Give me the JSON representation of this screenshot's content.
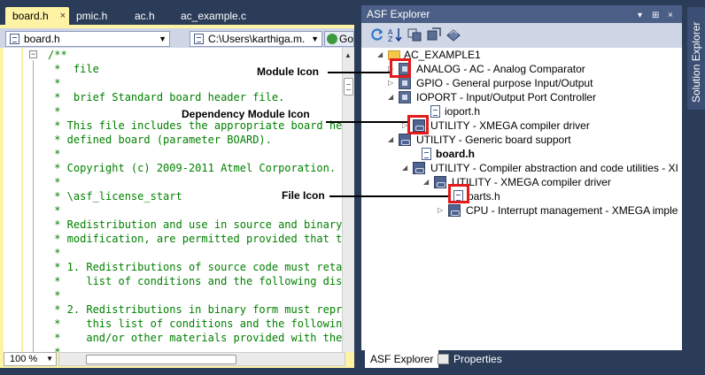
{
  "editor": {
    "tabs": [
      {
        "label": "board.h",
        "close": "×"
      },
      {
        "label": "pmic.h"
      },
      {
        "label": "ac.h"
      },
      {
        "label": "ac_example.c"
      }
    ],
    "file_combo": "board.h",
    "path_combo": "C:\\Users\\karthiga.m.",
    "go_label": "Go",
    "collapse": "−",
    "code_lines": [
      "/**",
      " *  file",
      " *",
      " *  brief Standard board header file.",
      " *",
      " * This file includes the appropriate board heade",
      " * defined board (parameter BOARD).",
      " *",
      " * Copyright (c) 2009-2011 Atmel Corporation. All",
      " *",
      " * \\asf_license_start",
      " *",
      " * Redistribution and use in source and binary fo",
      " * modification, are permitted provided that the ",
      " *",
      " * 1. Redistributions of source code must retain ",
      " *    list of conditions and the following discla",
      " *",
      " * 2. Redistributions in binary form must reprodu",
      " *    this list of conditions and the following ",
      " *    and/or other materials provided with the di",
      " *"
    ],
    "zoom": "100 %"
  },
  "asf": {
    "title": "ASF Explorer",
    "header_buttons": [
      "▾",
      "⊞",
      "×"
    ],
    "tree": [
      {
        "label": "AC_EXAMPLE1",
        "icon": "folder-icon",
        "exp": "◢"
      },
      {
        "label": "ANALOG - AC - Analog Comparator",
        "icon": "module-icon",
        "exp": "▷"
      },
      {
        "label": "GPIO - General purpose Input/Output",
        "icon": "module-icon",
        "exp": "▷"
      },
      {
        "label": "IOPORT - Input/Output Port Controller",
        "icon": "module-icon",
        "exp": "◢"
      },
      {
        "label": "ioport.h",
        "icon": "file-icon",
        "exp": ""
      },
      {
        "label": "UTILITY - XMEGA compiler driver",
        "icon": "dependency-module-icon",
        "exp": "▷"
      },
      {
        "label": "UTILITY - Generic board support",
        "icon": "dependency-module-icon",
        "exp": "◢"
      },
      {
        "label": "board.h",
        "icon": "file-icon",
        "exp": "",
        "bold": true
      },
      {
        "label": "UTILITY - Compiler abstraction and code utilities - XI",
        "icon": "dependency-module-icon",
        "exp": "◢"
      },
      {
        "label": "UTILITY - XMEGA compiler driver",
        "icon": "dependency-module-icon",
        "exp": "◢"
      },
      {
        "label": "parts.h",
        "icon": "file-icon",
        "exp": ""
      },
      {
        "label": "CPU - Interrupt management - XMEGA imple",
        "icon": "dependency-module-icon",
        "exp": "▷"
      }
    ],
    "bottom_tabs": {
      "explorer": "ASF Explorer",
      "properties": "Properties"
    }
  },
  "side_tab": "Solution Explorer",
  "annotations": {
    "module_icon": "Module Icon",
    "dependency_module_icon": "Dependency Module Icon",
    "file_icon": "File Icon"
  },
  "colors": {
    "frame": "#2b3c59",
    "active_tab": "#fef3a4",
    "comment_green": "#008000",
    "highlight_red": "#e21b1b"
  }
}
